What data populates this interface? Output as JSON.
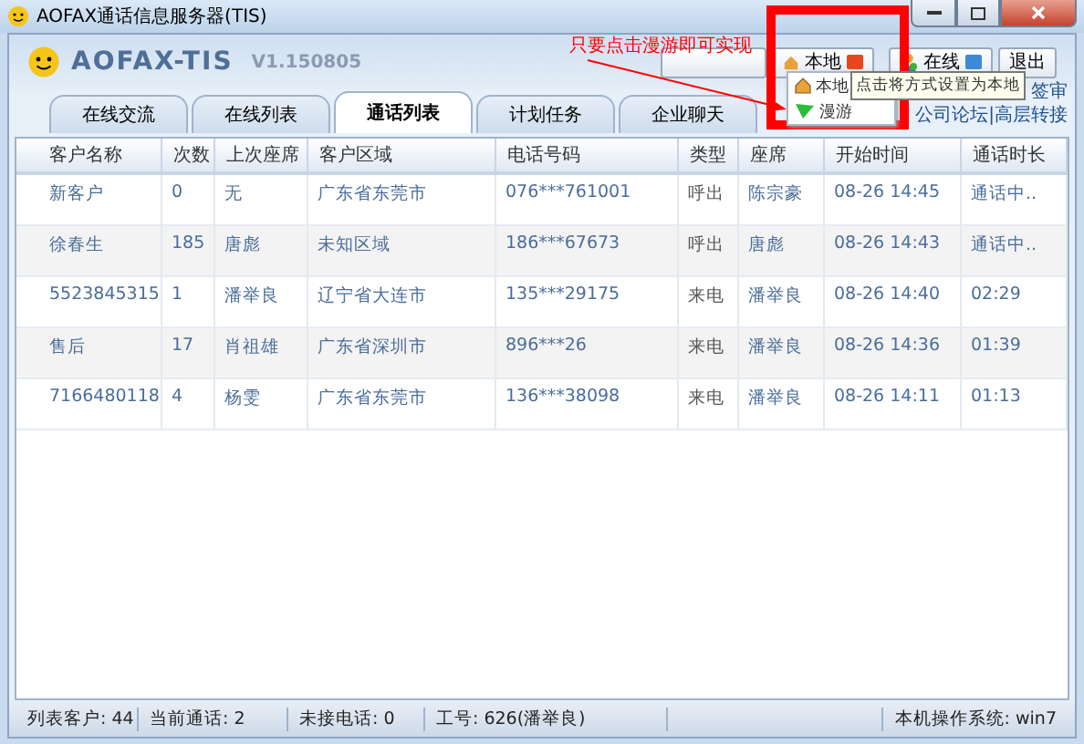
{
  "window": {
    "title": "AOFAX通话信息服务器(TIS)"
  },
  "app": {
    "logo": "AOFAX-TIS",
    "version": "V1.150805"
  },
  "header_buttons": [
    {
      "kind": "dropdown",
      "label": "本地"
    },
    {
      "kind": "status",
      "label": "在线"
    },
    {
      "kind": "plain",
      "label": "退出"
    }
  ],
  "links": [
    "签审",
    "公司论坛|高层转接"
  ],
  "tabs": [
    {
      "label": "在线交流",
      "selected": false
    },
    {
      "label": "在线列表",
      "selected": false
    },
    {
      "label": "通话列表",
      "selected": true
    },
    {
      "label": "计划任务",
      "selected": false
    },
    {
      "label": "企业聊天",
      "selected": false
    }
  ],
  "table": {
    "columns": [
      "客户名称",
      "次数",
      "上次座席",
      "客户区域",
      "电话号码",
      "类型",
      "座席",
      "开始时间",
      "通话时长"
    ],
    "rows": [
      [
        "新客户",
        "0",
        "无",
        "广东省东莞市",
        "076***761001",
        "呼出",
        "陈宗豪",
        "08-26 14:45",
        "通话中.."
      ],
      [
        "徐春生",
        "185",
        "唐彪",
        "未知区域",
        "186***67673",
        "呼出",
        "唐彪",
        "08-26 14:43",
        "通话中.."
      ],
      [
        "5523845315",
        "1",
        "潘举良",
        "辽宁省大连市",
        "135***29175",
        "来电",
        "潘举良",
        "08-26 14:40",
        "02:29"
      ],
      [
        "售后",
        "17",
        "肖祖雄",
        "广东省深圳市",
        "896***26",
        "来电",
        "潘举良",
        "08-26 14:36",
        "01:39"
      ],
      [
        "7166480118",
        "4",
        "杨雯",
        "广东省东莞市",
        "136***38098",
        "来电",
        "潘举良",
        "08-26 14:11",
        "01:13"
      ]
    ]
  },
  "status_bar": [
    "列表客户: 44",
    "当前通话: 2",
    "未接电话: 0",
    "工号: 626(潘举良)",
    "本机操作系统: win7"
  ],
  "annotation": {
    "text": "只要点击漫游即可实现"
  },
  "menu": [
    {
      "kind": "home",
      "label": "本地"
    },
    {
      "kind": "flag",
      "label": "漫游"
    }
  ],
  "tooltip": "点击将方式设置为本地"
}
